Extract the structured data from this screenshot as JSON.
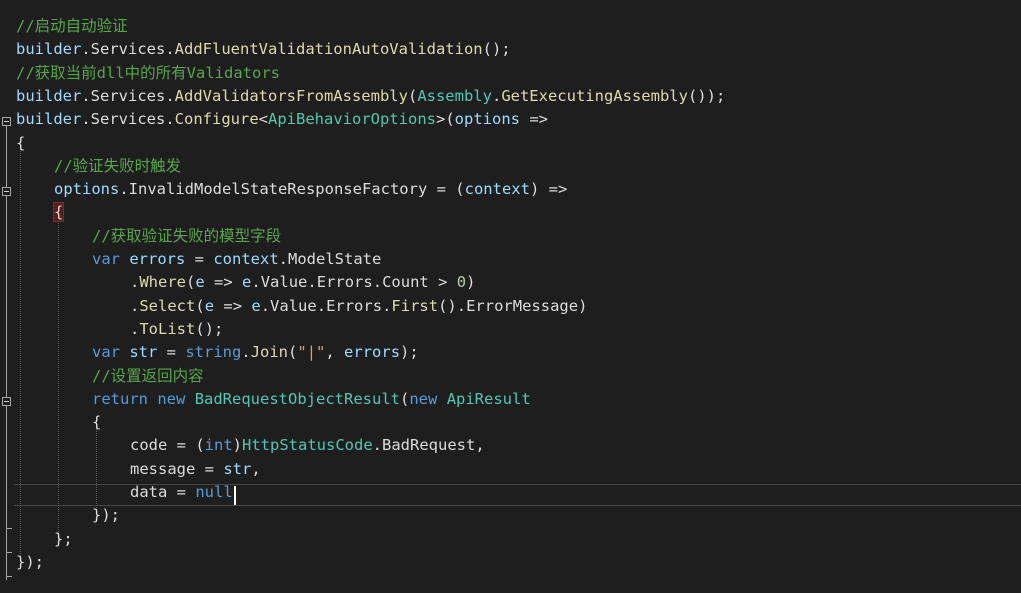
{
  "editor": {
    "lines": [
      {
        "indent": 0,
        "tokens": [
          {
            "t": "//启动自动验证",
            "k": "comment"
          }
        ]
      },
      {
        "indent": 0,
        "tokens": [
          {
            "t": "builder",
            "k": "ident"
          },
          {
            "t": ".",
            "k": "punct"
          },
          {
            "t": "Services",
            "k": "plain"
          },
          {
            "t": ".",
            "k": "punct"
          },
          {
            "t": "AddFluentValidationAutoValidation",
            "k": "method"
          },
          {
            "t": "();",
            "k": "punct"
          }
        ]
      },
      {
        "indent": 0,
        "tokens": [
          {
            "t": "//获取当前dll中的所有Validators",
            "k": "comment"
          }
        ]
      },
      {
        "indent": 0,
        "tokens": [
          {
            "t": "builder",
            "k": "ident"
          },
          {
            "t": ".",
            "k": "punct"
          },
          {
            "t": "Services",
            "k": "plain"
          },
          {
            "t": ".",
            "k": "punct"
          },
          {
            "t": "AddValidatorsFromAssembly",
            "k": "method"
          },
          {
            "t": "(",
            "k": "punct"
          },
          {
            "t": "Assembly",
            "k": "type"
          },
          {
            "t": ".",
            "k": "punct"
          },
          {
            "t": "GetExecutingAssembly",
            "k": "method"
          },
          {
            "t": "());",
            "k": "punct"
          }
        ]
      },
      {
        "indent": 0,
        "tokens": [
          {
            "t": "builder",
            "k": "ident"
          },
          {
            "t": ".",
            "k": "punct"
          },
          {
            "t": "Services",
            "k": "plain"
          },
          {
            "t": ".",
            "k": "punct"
          },
          {
            "t": "Configure",
            "k": "method"
          },
          {
            "t": "<",
            "k": "punct"
          },
          {
            "t": "ApiBehaviorOptions",
            "k": "type"
          },
          {
            "t": ">(",
            "k": "punct"
          },
          {
            "t": "options",
            "k": "ident"
          },
          {
            "t": " =>",
            "k": "punct"
          }
        ]
      },
      {
        "indent": 0,
        "tokens": [
          {
            "t": "{",
            "k": "punct"
          }
        ]
      },
      {
        "indent": 1,
        "tokens": [
          {
            "t": "//验证失败时触发",
            "k": "comment"
          }
        ]
      },
      {
        "indent": 1,
        "tokens": [
          {
            "t": "options",
            "k": "ident"
          },
          {
            "t": ".",
            "k": "punct"
          },
          {
            "t": "InvalidModelStateResponseFactory",
            "k": "plain"
          },
          {
            "t": " = (",
            "k": "punct"
          },
          {
            "t": "context",
            "k": "ident"
          },
          {
            "t": ") =>",
            "k": "punct"
          }
        ]
      },
      {
        "indent": 1,
        "tokens": [
          {
            "t": "{",
            "k": "brace-hl"
          }
        ]
      },
      {
        "indent": 2,
        "tokens": [
          {
            "t": "//获取验证失败的模型字段",
            "k": "comment"
          }
        ]
      },
      {
        "indent": 2,
        "tokens": [
          {
            "t": "var",
            "k": "keyword"
          },
          {
            "t": " ",
            "k": "plain"
          },
          {
            "t": "errors",
            "k": "ident"
          },
          {
            "t": " = ",
            "k": "punct"
          },
          {
            "t": "context",
            "k": "ident"
          },
          {
            "t": ".",
            "k": "punct"
          },
          {
            "t": "ModelState",
            "k": "plain"
          }
        ]
      },
      {
        "indent": 3,
        "tokens": [
          {
            "t": ".",
            "k": "punct"
          },
          {
            "t": "Where",
            "k": "method"
          },
          {
            "t": "(",
            "k": "punct"
          },
          {
            "t": "e",
            "k": "ident"
          },
          {
            "t": " => ",
            "k": "punct"
          },
          {
            "t": "e",
            "k": "ident"
          },
          {
            "t": ".",
            "k": "punct"
          },
          {
            "t": "Value",
            "k": "plain"
          },
          {
            "t": ".",
            "k": "punct"
          },
          {
            "t": "Errors",
            "k": "plain"
          },
          {
            "t": ".",
            "k": "punct"
          },
          {
            "t": "Count",
            "k": "plain"
          },
          {
            "t": " > ",
            "k": "punct"
          },
          {
            "t": "0",
            "k": "number"
          },
          {
            "t": ")",
            "k": "punct"
          }
        ]
      },
      {
        "indent": 3,
        "tokens": [
          {
            "t": ".",
            "k": "punct"
          },
          {
            "t": "Select",
            "k": "method"
          },
          {
            "t": "(",
            "k": "punct"
          },
          {
            "t": "e",
            "k": "ident"
          },
          {
            "t": " => ",
            "k": "punct"
          },
          {
            "t": "e",
            "k": "ident"
          },
          {
            "t": ".",
            "k": "punct"
          },
          {
            "t": "Value",
            "k": "plain"
          },
          {
            "t": ".",
            "k": "punct"
          },
          {
            "t": "Errors",
            "k": "plain"
          },
          {
            "t": ".",
            "k": "punct"
          },
          {
            "t": "First",
            "k": "method"
          },
          {
            "t": "().",
            "k": "punct"
          },
          {
            "t": "ErrorMessage",
            "k": "plain"
          },
          {
            "t": ")",
            "k": "punct"
          }
        ]
      },
      {
        "indent": 3,
        "tokens": [
          {
            "t": ".",
            "k": "punct"
          },
          {
            "t": "ToList",
            "k": "method"
          },
          {
            "t": "();",
            "k": "punct"
          }
        ]
      },
      {
        "indent": 2,
        "tokens": [
          {
            "t": "var",
            "k": "keyword"
          },
          {
            "t": " ",
            "k": "plain"
          },
          {
            "t": "str",
            "k": "ident"
          },
          {
            "t": " = ",
            "k": "punct"
          },
          {
            "t": "string",
            "k": "keyword"
          },
          {
            "t": ".",
            "k": "punct"
          },
          {
            "t": "Join",
            "k": "method"
          },
          {
            "t": "(",
            "k": "punct"
          },
          {
            "t": "\"|\"",
            "k": "string"
          },
          {
            "t": ", ",
            "k": "punct"
          },
          {
            "t": "errors",
            "k": "ident"
          },
          {
            "t": ");",
            "k": "punct"
          }
        ]
      },
      {
        "indent": 2,
        "tokens": [
          {
            "t": "//设置返回内容",
            "k": "comment"
          }
        ]
      },
      {
        "indent": 2,
        "tokens": [
          {
            "t": "return",
            "k": "keyword"
          },
          {
            "t": " ",
            "k": "plain"
          },
          {
            "t": "new",
            "k": "keyword"
          },
          {
            "t": " ",
            "k": "plain"
          },
          {
            "t": "BadRequestObjectResult",
            "k": "type"
          },
          {
            "t": "(",
            "k": "punct"
          },
          {
            "t": "new",
            "k": "keyword"
          },
          {
            "t": " ",
            "k": "plain"
          },
          {
            "t": "ApiResult",
            "k": "type"
          }
        ]
      },
      {
        "indent": 2,
        "tokens": [
          {
            "t": "{",
            "k": "punct"
          }
        ]
      },
      {
        "indent": 3,
        "tokens": [
          {
            "t": "code",
            "k": "plain"
          },
          {
            "t": " = (",
            "k": "punct"
          },
          {
            "t": "int",
            "k": "keyword"
          },
          {
            "t": ")",
            "k": "punct"
          },
          {
            "t": "HttpStatusCode",
            "k": "type"
          },
          {
            "t": ".",
            "k": "punct"
          },
          {
            "t": "BadRequest",
            "k": "plain"
          },
          {
            "t": ",",
            "k": "punct"
          }
        ]
      },
      {
        "indent": 3,
        "tokens": [
          {
            "t": "message",
            "k": "plain"
          },
          {
            "t": " = ",
            "k": "punct"
          },
          {
            "t": "str",
            "k": "ident"
          },
          {
            "t": ",",
            "k": "punct"
          }
        ]
      },
      {
        "indent": 3,
        "tokens": [
          {
            "t": "data",
            "k": "plain"
          },
          {
            "t": " = ",
            "k": "punct"
          },
          {
            "t": "null",
            "k": "keyword"
          }
        ]
      },
      {
        "indent": 2,
        "tokens": [
          {
            "t": "});",
            "k": "punct"
          }
        ]
      },
      {
        "indent": 1,
        "tokens": [
          {
            "t": "};",
            "k": "punct"
          }
        ]
      },
      {
        "indent": 0,
        "tokens": [
          {
            "t": "});",
            "k": "punct"
          }
        ]
      }
    ]
  },
  "colors": {
    "background": "#1e1e1e",
    "comment": "#57a64a",
    "identifier": "#9cdcfe",
    "method": "#dcdcaa",
    "type": "#4ec9b0",
    "keyword": "#569cd6",
    "string": "#d69d85",
    "number": "#b5cea8",
    "plain": "#dcdcdc"
  }
}
